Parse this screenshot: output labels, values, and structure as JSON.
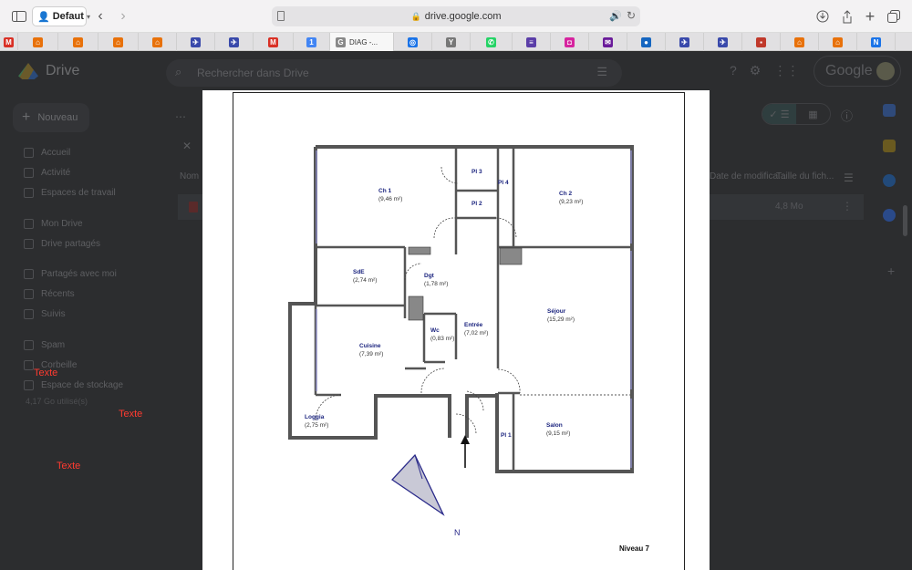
{
  "browser": {
    "profile_name": "Defaut",
    "url": "drive.google.com",
    "active_tab_label": "DIAG -...",
    "tab_favicons": [
      {
        "icon": "gmail-icon",
        "color": "#d93025",
        "glyph": "M"
      },
      {
        "icon": "home-icon",
        "color": "#e8710a",
        "glyph": "⌂"
      },
      {
        "icon": "home-icon",
        "color": "#e8710a",
        "glyph": "⌂"
      },
      {
        "icon": "home-icon",
        "color": "#e8710a",
        "glyph": "⌂"
      },
      {
        "icon": "home-icon",
        "color": "#e8710a",
        "glyph": "⌂"
      },
      {
        "icon": "bird-icon",
        "color": "#3949ab",
        "glyph": "✈"
      },
      {
        "icon": "bird-icon",
        "color": "#3949ab",
        "glyph": "✈"
      },
      {
        "icon": "gmail-icon",
        "color": "#d93025",
        "glyph": "M"
      },
      {
        "icon": "calendar-icon",
        "color": "#4285f4",
        "glyph": "1"
      },
      {
        "icon": "drive-doc-icon",
        "color": "#888888",
        "glyph": "G"
      },
      {
        "icon": "target-icon",
        "color": "#1a73e8",
        "glyph": "◎"
      },
      {
        "icon": "yahoo-icon",
        "color": "#777777",
        "glyph": "Y"
      },
      {
        "icon": "whatsapp-icon",
        "color": "#25d366",
        "glyph": "✆"
      },
      {
        "icon": "list-icon",
        "color": "#5b3ea8",
        "glyph": "≡"
      },
      {
        "icon": "instagram-icon",
        "color": "#d6249f",
        "glyph": "◘"
      },
      {
        "icon": "mail-icon",
        "color": "#6a1b9a",
        "glyph": "✉"
      },
      {
        "icon": "circle-icon",
        "color": "#1565c0",
        "glyph": "●"
      },
      {
        "icon": "bird-icon",
        "color": "#3949ab",
        "glyph": "✈"
      },
      {
        "icon": "bird-icon",
        "color": "#3949ab",
        "glyph": "✈"
      },
      {
        "icon": "app-icon",
        "color": "#c0392b",
        "glyph": "▪"
      },
      {
        "icon": "home-icon",
        "color": "#e8710a",
        "glyph": "⌂"
      },
      {
        "icon": "home-icon",
        "color": "#e8710a",
        "glyph": "⌂"
      },
      {
        "icon": "notion-icon",
        "color": "#1a73e8",
        "glyph": "N"
      }
    ]
  },
  "drive": {
    "app_name": "Drive",
    "search_placeholder": "Rechercher dans Drive",
    "new_button": "Nouveau",
    "nav": [
      {
        "label": "Accueil",
        "icon": "home-icon"
      },
      {
        "label": "Activité",
        "icon": "activity-icon"
      },
      {
        "label": "Espaces de travail",
        "icon": "workspace-icon"
      },
      {
        "label": "Mon Drive",
        "icon": "drive-icon"
      },
      {
        "label": "Drive partagés",
        "icon": "shared-drive-icon"
      },
      {
        "label": "Partagés avec moi",
        "icon": "people-icon"
      },
      {
        "label": "Récents",
        "icon": "clock-icon"
      },
      {
        "label": "Suivis",
        "icon": "star-icon"
      },
      {
        "label": "Spam",
        "icon": "spam-icon"
      },
      {
        "label": "Corbeille",
        "icon": "trash-icon"
      },
      {
        "label": "Espace de stockage",
        "icon": "cloud-icon"
      }
    ],
    "storage_used": "4,17 Go utilisé(s)",
    "brand": "Google",
    "column_name": "Nom",
    "column_modified": "Date de modifica...",
    "column_size": "Taille du fich...",
    "file_size": "4,8 Mo"
  },
  "document": {
    "level_label": "Niveau 7",
    "north_label": "N",
    "rooms": [
      {
        "name": "Ch 1",
        "area": "(9,46 m²)"
      },
      {
        "name": "Pl 3",
        "area": ""
      },
      {
        "name": "Pl 4",
        "area": ""
      },
      {
        "name": "Ch 2",
        "area": "(9,23 m²)"
      },
      {
        "name": "Pl 2",
        "area": ""
      },
      {
        "name": "SdE",
        "area": "(2,74 m²)"
      },
      {
        "name": "Dgt",
        "area": "(1,78 m²)"
      },
      {
        "name": "Séjour",
        "area": "(15,29 m²)"
      },
      {
        "name": "Wc",
        "area": "(0,83 m²)"
      },
      {
        "name": "Entrée",
        "area": "(7,02 m²)"
      },
      {
        "name": "Cuisine",
        "area": "(7,39 m²)"
      },
      {
        "name": "Loggia",
        "area": "(2,75 m²)"
      },
      {
        "name": "Pl 1",
        "area": ""
      },
      {
        "name": "Salon",
        "area": "(9,15 m²)"
      }
    ]
  },
  "overlay_texts": [
    "Texte",
    "Texte",
    "Texte"
  ],
  "colors": {
    "overlay_text": "#ff3b30",
    "plan_label": "#1a237e"
  }
}
